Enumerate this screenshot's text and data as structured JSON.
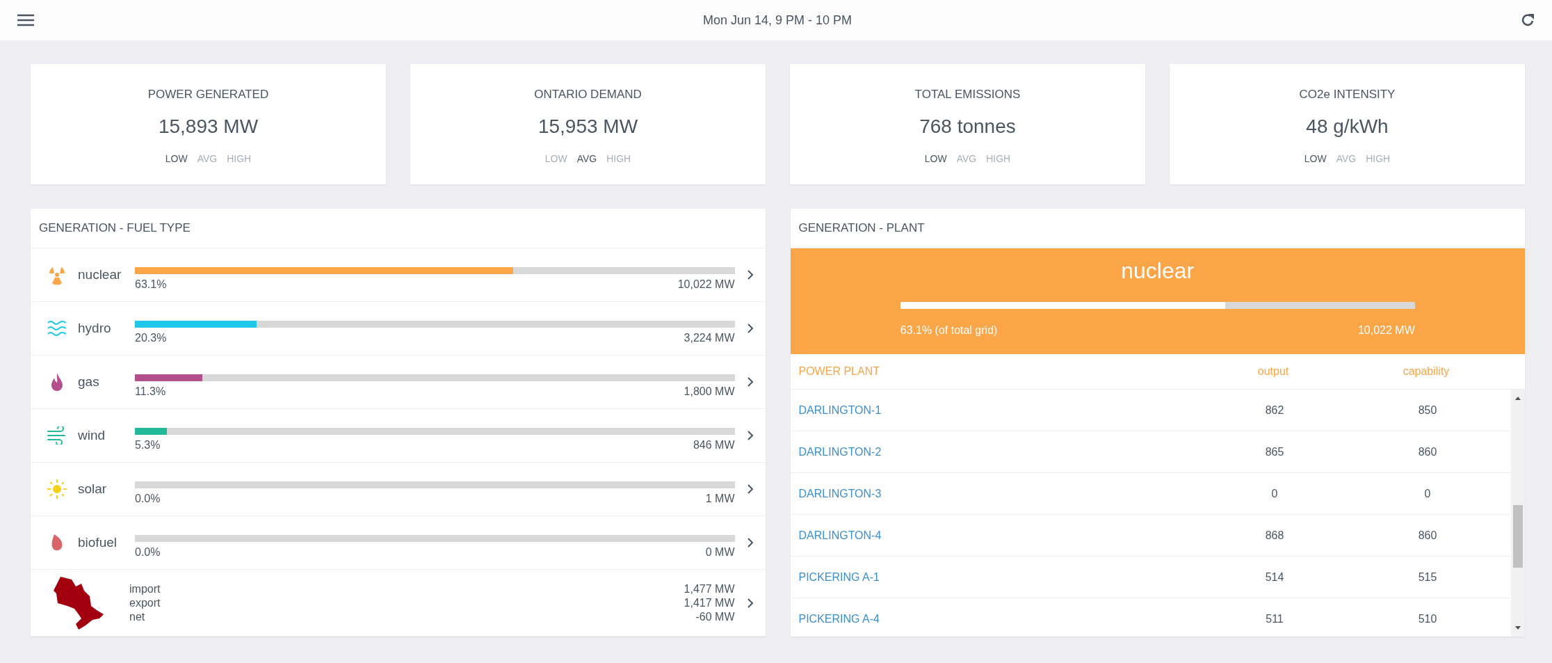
{
  "header": {
    "title": "Mon Jun 14, 9 PM - 10 PM"
  },
  "cards": [
    {
      "title": "POWER GENERATED",
      "value": "15,893 MW",
      "levels": [
        {
          "label": "LOW",
          "selected": true
        },
        {
          "label": "AVG",
          "selected": false
        },
        {
          "label": "HIGH",
          "selected": false
        }
      ]
    },
    {
      "title": "ONTARIO DEMAND",
      "value": "15,953 MW",
      "levels": [
        {
          "label": "LOW",
          "selected": false
        },
        {
          "label": "AVG",
          "selected": true
        },
        {
          "label": "HIGH",
          "selected": false
        }
      ]
    },
    {
      "title": "TOTAL EMISSIONS",
      "value": "768 tonnes",
      "levels": [
        {
          "label": "LOW",
          "selected": true
        },
        {
          "label": "AVG",
          "selected": false
        },
        {
          "label": "HIGH",
          "selected": false
        }
      ]
    },
    {
      "title": "CO2e INTENSITY",
      "value": "48 g/kWh",
      "levels": [
        {
          "label": "LOW",
          "selected": true
        },
        {
          "label": "AVG",
          "selected": false
        },
        {
          "label": "HIGH",
          "selected": false
        }
      ]
    }
  ],
  "fuel_panel": {
    "title": "GENERATION - FUEL TYPE",
    "rows": [
      {
        "kind": "fuel",
        "name": "nuclear",
        "color": "#f9a548",
        "level": 0.631,
        "percent": "63.1%",
        "output": "10,022 MW"
      },
      {
        "kind": "fuel",
        "name": "hydro",
        "color": "#1ec8ea",
        "level": 0.203,
        "percent": "20.3%",
        "output": "3,224 MW"
      },
      {
        "kind": "fuel",
        "name": "gas",
        "color": "#b3508c",
        "level": 0.113,
        "percent": "11.3%",
        "output": "1,800 MW"
      },
      {
        "kind": "fuel",
        "name": "wind",
        "color": "#21b99a",
        "level": 0.053,
        "percent": "5.3%",
        "output": "846 MW"
      },
      {
        "kind": "fuel",
        "name": "solar",
        "color": "#f5d21a",
        "level": 0.0,
        "percent": "0.0%",
        "output": "1 MW"
      },
      {
        "kind": "fuel",
        "name": "biofuel",
        "color": "#d9646a",
        "level": 0.0,
        "percent": "0.0%",
        "output": "0 MW"
      },
      {
        "kind": "interchange",
        "lines": [
          {
            "label": "import",
            "value": "1,477 MW"
          },
          {
            "label": "export",
            "value": "1,417 MW"
          },
          {
            "label": "net",
            "value": "-60 MW"
          }
        ]
      }
    ]
  },
  "plant_panel": {
    "title": "GENERATION - PLANT",
    "fuel": "nuclear",
    "color": "#f9a548",
    "level": 0.631,
    "share": "63.1% (of total grid)",
    "output": "10,022 MW",
    "columns": [
      "POWER PLANT",
      "output",
      "capability"
    ],
    "rows": [
      {
        "plant": "DARLINGTON-1",
        "output": "862",
        "capability": "850"
      },
      {
        "plant": "DARLINGTON-2",
        "output": "865",
        "capability": "860"
      },
      {
        "plant": "DARLINGTON-3",
        "output": "0",
        "capability": "0"
      },
      {
        "plant": "DARLINGTON-4",
        "output": "868",
        "capability": "860"
      },
      {
        "plant": "PICKERING A-1",
        "output": "514",
        "capability": "515"
      },
      {
        "plant": "PICKERING A-4",
        "output": "511",
        "capability": "510"
      }
    ]
  }
}
